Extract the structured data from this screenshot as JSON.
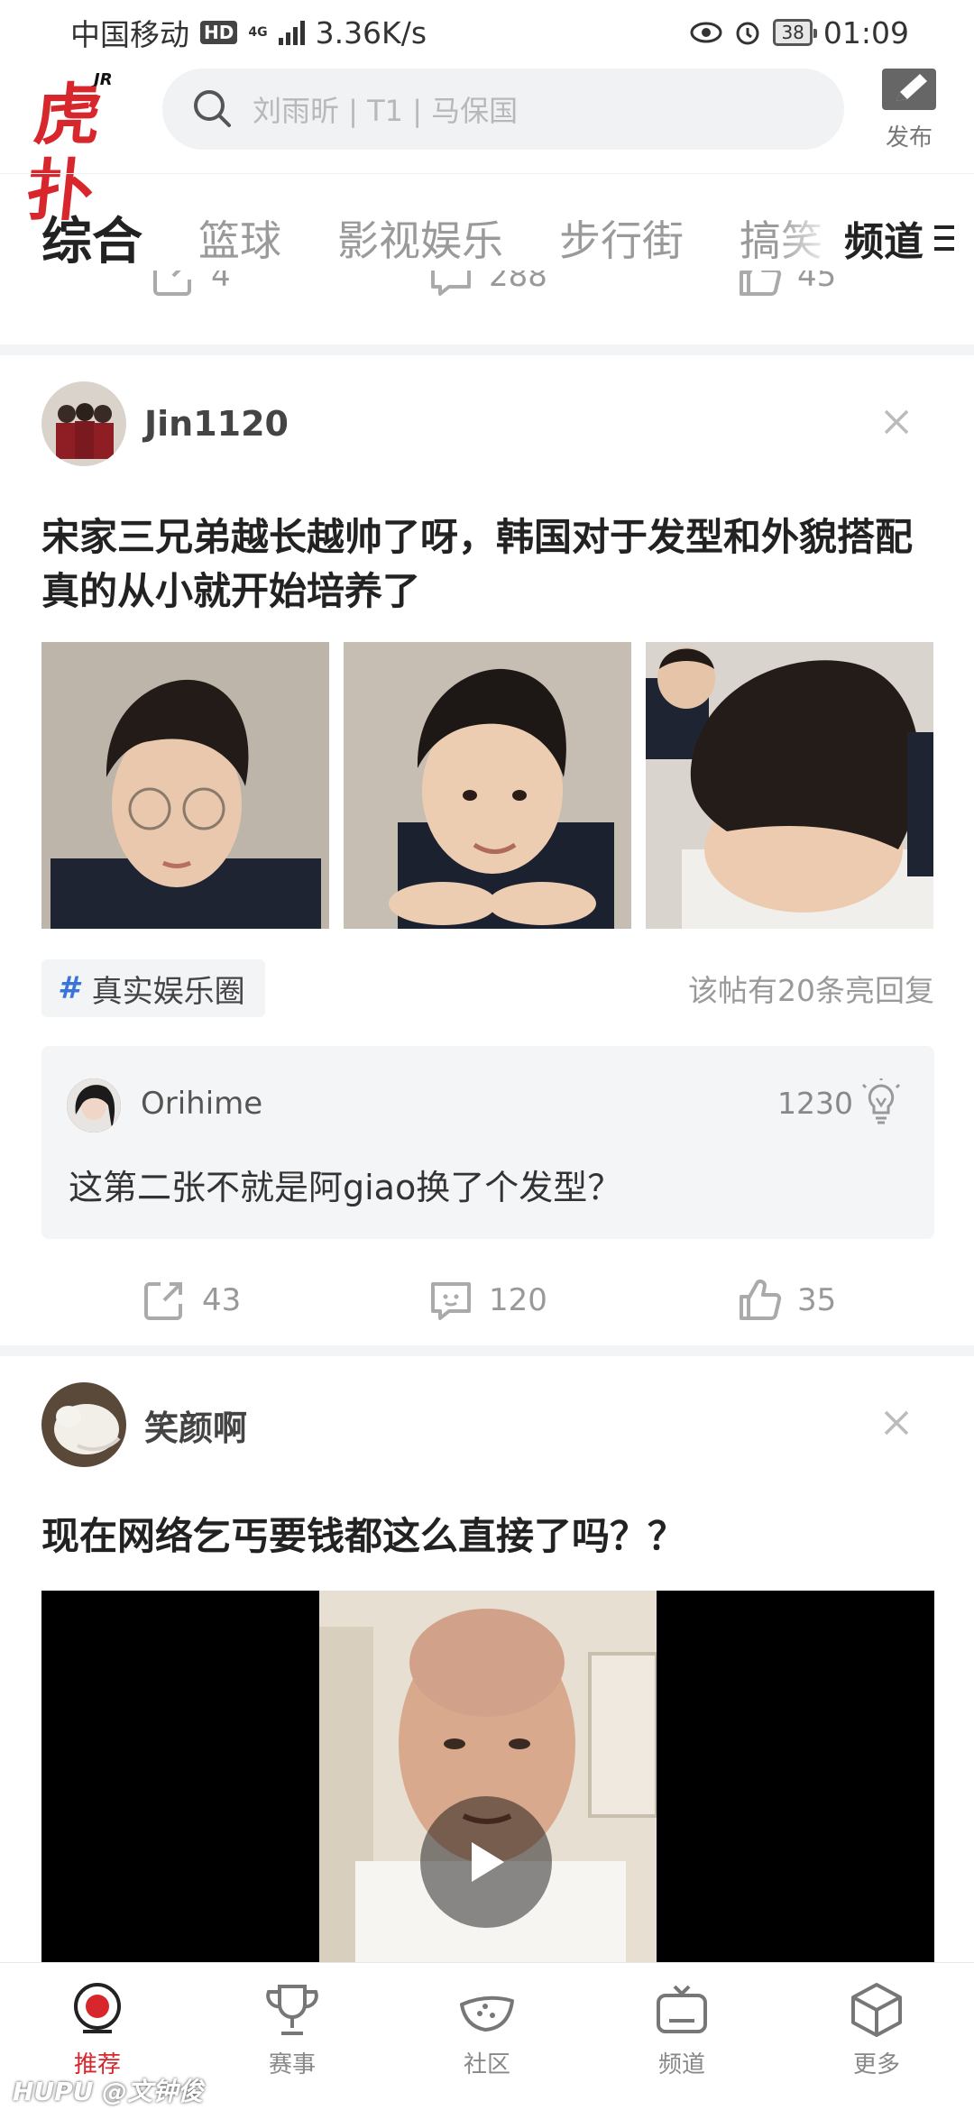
{
  "status_bar": {
    "carrier": "中国移动",
    "hd": "HD",
    "network": "4G",
    "speed": "3.36K/s",
    "battery": "38",
    "time": "01:09"
  },
  "header": {
    "logo_jr": "JR",
    "logo_text": "虎扑",
    "search_placeholder": "刘雨昕 | T1 | 马保国",
    "publish_label": "发布"
  },
  "tabs": {
    "items": [
      "综合",
      "篮球",
      "影视娱乐",
      "步行街",
      "搞笑"
    ],
    "active_index": 0,
    "channel_label": "频道"
  },
  "prev_post_actions": {
    "share": "4",
    "comment": "288",
    "like": "45"
  },
  "post1": {
    "username": "Jin1120",
    "title": "宋家三兄弟越长越帅了呀，韩国对于发型和外貌搭配真的从小就开始培养了",
    "tag": "真实娱乐圈",
    "reply_summary": "该帖有20条亮回复",
    "top_comment": {
      "user": "Orihime",
      "likes": "1230",
      "text": "这第二张不就是阿giao换了个发型？"
    },
    "actions": {
      "share": "43",
      "comment": "120",
      "like": "35"
    }
  },
  "post2": {
    "username": "笑颜啊",
    "title": "现在网络乞丐要钱都这么直接了吗？？"
  },
  "bottom_nav": {
    "items": [
      {
        "label": "推荐",
        "icon": "recommend-icon"
      },
      {
        "label": "赛事",
        "icon": "trophy-icon"
      },
      {
        "label": "社区",
        "icon": "community-icon"
      },
      {
        "label": "频道",
        "icon": "tv-icon"
      },
      {
        "label": "更多",
        "icon": "cube-icon"
      }
    ],
    "active_index": 0
  },
  "watermark": "HUPU @文钟俊",
  "colors": {
    "brand_red": "#d7272c",
    "tag_blue": "#3b74d9"
  }
}
